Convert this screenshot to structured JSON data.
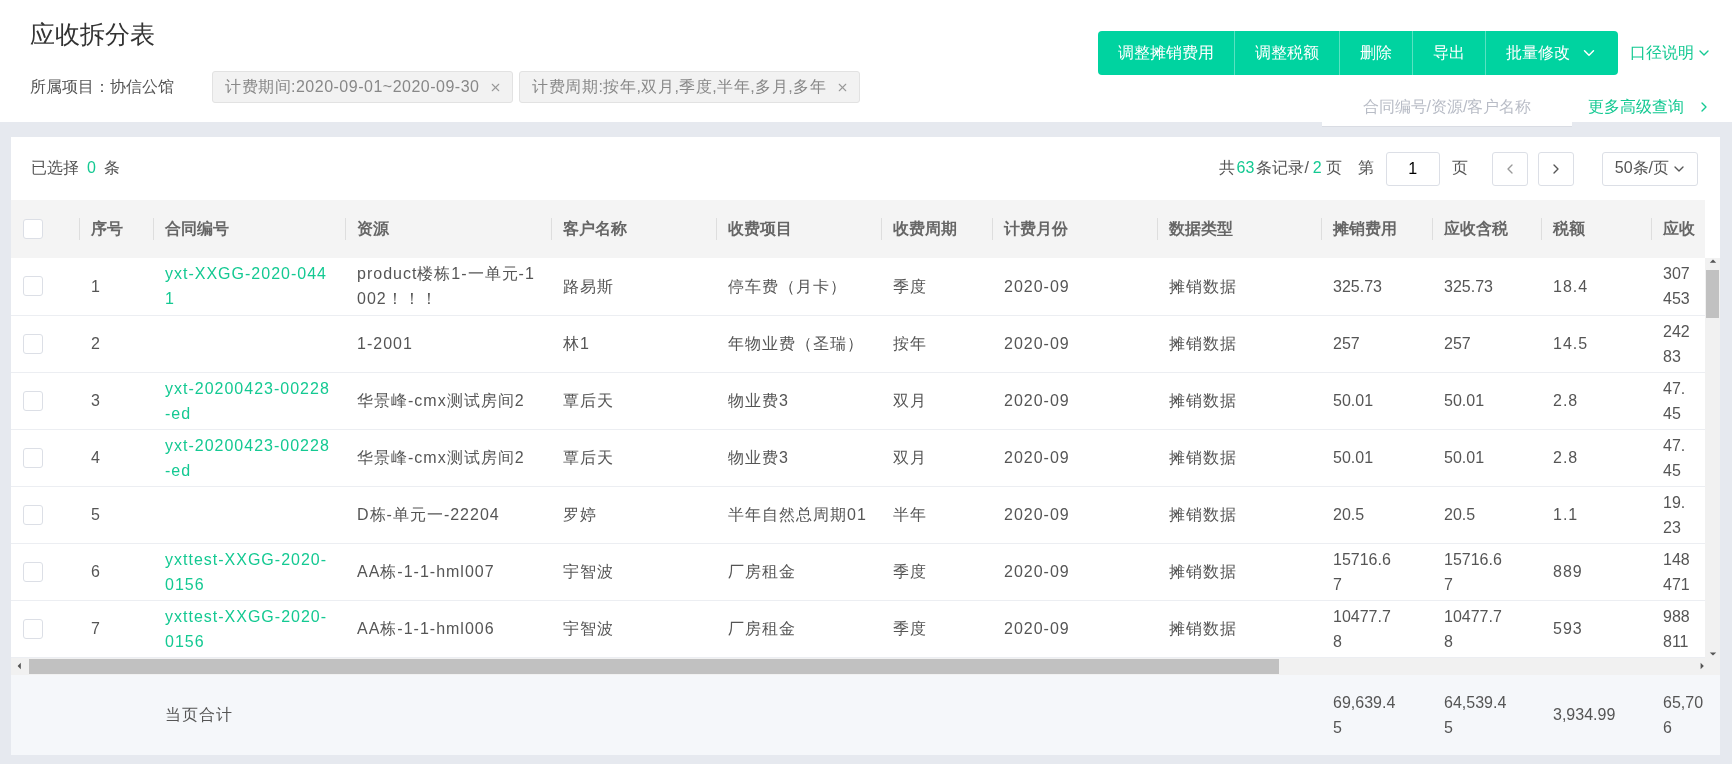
{
  "page": {
    "title": "应收拆分表",
    "project_label": "所属项目：",
    "project": "协信公馆"
  },
  "filters": [
    {
      "text": "计费期间:2020-09-01~2020-09-30"
    },
    {
      "text": "计费周期:按年,双月,季度,半年,多月,多年"
    }
  ],
  "actions": [
    {
      "label": "调整摊销费用",
      "kind": "plain"
    },
    {
      "label": "调整税额",
      "kind": "plain"
    },
    {
      "label": "删除",
      "kind": "plain"
    },
    {
      "label": "导出",
      "kind": "plain"
    },
    {
      "label": "批量修改",
      "kind": "menu"
    }
  ],
  "caliber_link": "口径说明",
  "search": {
    "placeholder": "合同编号/资源/客户名称"
  },
  "advanced_link": "更多高级查询",
  "selection": {
    "prefix": "已选择",
    "count": "0",
    "suffix": "条"
  },
  "pagination": {
    "total_prefix": "共",
    "total": "63",
    "total_suffix": "条记录/",
    "pages": "2",
    "pages_suffix": "页",
    "goto_prefix": "第",
    "page": "1",
    "goto_suffix": "页",
    "page_size": "50条/页"
  },
  "table": {
    "select_all": {
      "checked": false
    },
    "columns": [
      {
        "label": "序号",
        "kind": "text"
      },
      {
        "label": "合同编号",
        "kind": "link"
      },
      {
        "label": "资源",
        "kind": "text"
      },
      {
        "label": "客户名称",
        "kind": "text"
      },
      {
        "label": "收费项目",
        "kind": "text"
      },
      {
        "label": "收费周期",
        "kind": "text"
      },
      {
        "label": "计费月份",
        "kind": "text"
      },
      {
        "label": "数据类型",
        "kind": "text"
      },
      {
        "label": "摊销费用",
        "kind": "amount"
      },
      {
        "label": "应收含税",
        "kind": "amount"
      },
      {
        "label": "税额",
        "kind": "text"
      },
      {
        "label": "应收",
        "kind": "narrow"
      }
    ],
    "rows": [
      {
        "checked": false,
        "cells": [
          "1",
          "yxt-XXGG-2020-0441",
          "product楼栋1-一单元-1002！！！",
          "路易斯",
          "停车费（月卡）",
          "季度",
          "2020-09",
          "摊销数据",
          "325.73",
          "325.73",
          "18.4",
          "307453"
        ]
      },
      {
        "checked": false,
        "cells": [
          "2",
          null,
          "1-2001",
          "林1",
          "年物业费（圣瑞）",
          "按年",
          "2020-09",
          "摊销数据",
          "257",
          "257",
          "14.5",
          "24283"
        ]
      },
      {
        "checked": false,
        "cells": [
          "3",
          "yxt-20200423-00228-ed",
          "华景峰-cmx测试房间2",
          "覃后天",
          "物业费3",
          "双月",
          "2020-09",
          "摊销数据",
          "50.01",
          "50.01",
          "2.8",
          "47.45"
        ]
      },
      {
        "checked": false,
        "cells": [
          "4",
          "yxt-20200423-00228-ed",
          "华景峰-cmx测试房间2",
          "覃后天",
          "物业费3",
          "双月",
          "2020-09",
          "摊销数据",
          "50.01",
          "50.01",
          "2.8",
          "47.45"
        ]
      },
      {
        "checked": false,
        "cells": [
          "5",
          null,
          "D栋-单元一-22204",
          "罗婷",
          "半年自然总周期01",
          "半年",
          "2020-09",
          "摊销数据",
          "20.5",
          "20.5",
          "1.1",
          "19.23"
        ]
      },
      {
        "checked": false,
        "cells": [
          "6",
          "yxttest-XXGG-2020-0156",
          "AA栋-1-1-hml007",
          "宇智波",
          "厂房租金",
          "季度",
          "2020-09",
          "摊销数据",
          "15716.67",
          "15716.67",
          "889",
          "148471"
        ]
      },
      {
        "checked": false,
        "cells": [
          "7",
          "yxttest-XXGG-2020-0156",
          "AA栋-1-1-hml006",
          "宇智波",
          "厂房租金",
          "季度",
          "2020-09",
          "摊销数据",
          "10477.78",
          "10477.78",
          "593",
          "988811"
        ]
      }
    ],
    "totals": {
      "label": "当页合计",
      "values": [
        "69,639.45",
        "64,539.45",
        "3,934.99",
        "65,706"
      ]
    }
  }
}
